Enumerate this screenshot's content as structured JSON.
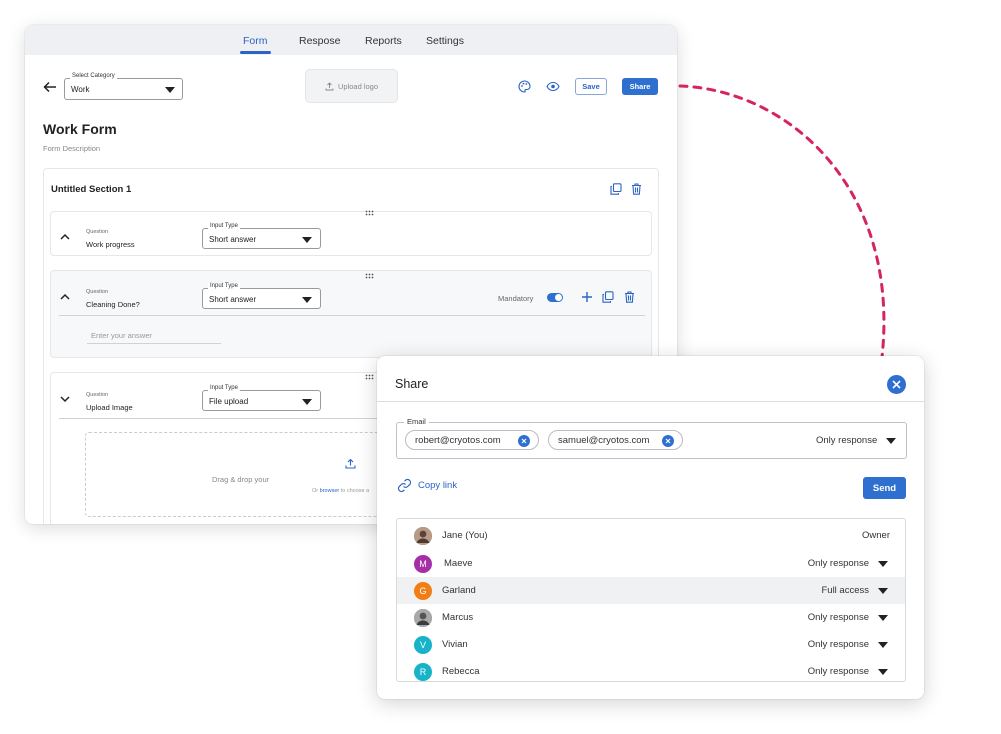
{
  "tabs": [
    {
      "label": "Form",
      "active": true
    },
    {
      "label": "Respose",
      "active": false
    },
    {
      "label": "Reports",
      "active": false
    },
    {
      "label": "Settings",
      "active": false
    }
  ],
  "header": {
    "category_label": "Select Category",
    "category_value": "Work",
    "upload_logo": "Upload logo",
    "save_label": "Save",
    "share_label": "Share"
  },
  "form": {
    "title": "Work Form",
    "description": "Form Description",
    "section_title": "Untitled Section 1",
    "questions": [
      {
        "label": "Question",
        "value": "Work progress",
        "input_type_label": "Input Type",
        "input_type": "Short answer"
      },
      {
        "label": "Question",
        "value": "Cleaning Done?",
        "input_type_label": "Input Type",
        "input_type": "Short answer",
        "mandatory_label": "Mandatory",
        "mandatory": true,
        "answer_placeholder": "Enter your answer"
      },
      {
        "label": "Question",
        "value": "Upload Image",
        "input_type_label": "Input Type",
        "input_type": "File upload",
        "drop_text": "Drag & drop your",
        "drop_sub_prefix": "Or",
        "drop_sub_link": "browser",
        "drop_sub_suffix": "to choose a"
      }
    ]
  },
  "share_dialog": {
    "title": "Share",
    "email_label": "Email",
    "emails": [
      "robert@cryotos.com",
      "samuel@cryotos.com"
    ],
    "email_permission": "Only response",
    "copy_link": "Copy link",
    "send_label": "Send",
    "people": [
      {
        "name": "Jane  (You)",
        "role": "Owner",
        "avatar": "photo",
        "initial": "",
        "color": "#8b6f5a",
        "dropdown": false
      },
      {
        "name": "Maeve",
        "role": "Only response",
        "avatar": "initial",
        "initial": "M",
        "color": "#a62fa8",
        "dropdown": true
      },
      {
        "name": "Garland",
        "role": "Full access",
        "avatar": "initial",
        "initial": "G",
        "color": "#f07d15",
        "dropdown": true
      },
      {
        "name": "Marcus",
        "role": "Only response",
        "avatar": "photo",
        "initial": "",
        "color": "#7d7d7d",
        "dropdown": true
      },
      {
        "name": "Vivian",
        "role": "Only response",
        "avatar": "initial",
        "initial": "V",
        "color": "#16b3c9",
        "dropdown": true
      },
      {
        "name": "Rebecca",
        "role": "Only response",
        "avatar": "initial",
        "initial": "R",
        "color": "#16b3c9",
        "dropdown": true
      }
    ]
  },
  "colors": {
    "accent": "#2f6fd0",
    "connector": "#d6245d",
    "highlight_row": "#f0f1f3"
  }
}
